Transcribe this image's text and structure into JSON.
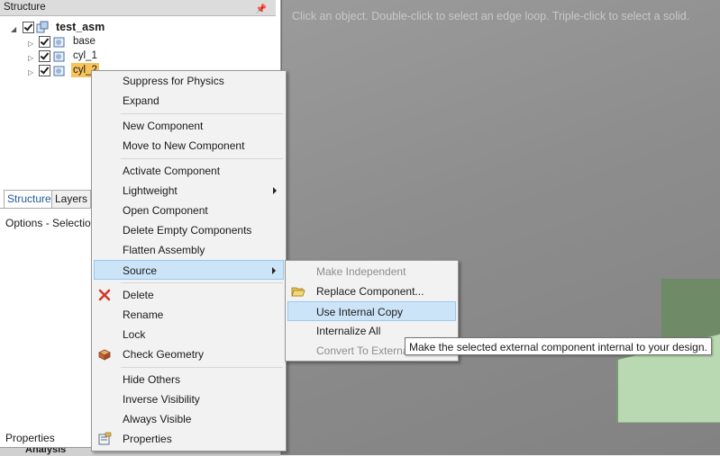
{
  "structure_panel": {
    "title": "Structure",
    "tree": [
      {
        "label": "test_asm"
      },
      {
        "label": "base"
      },
      {
        "label": "cyl_1"
      },
      {
        "label": "cyl_2"
      }
    ],
    "tabs": [
      "Structure",
      "Layers"
    ],
    "options_label": "Options - Selection",
    "properties_label": "Properties",
    "analysis_label": "Analysis"
  },
  "viewport": {
    "hint": "Click an object. Double-click to select an edge loop. Triple-click to select a solid."
  },
  "context_menu": {
    "items": [
      "Suppress for Physics",
      "Expand",
      "New Component",
      "Move to New Component",
      "Activate Component",
      "Lightweight",
      "Open Component",
      "Delete Empty Components",
      "Flatten Assembly",
      "Source",
      "Delete",
      "Rename",
      "Lock",
      "Check Geometry",
      "Hide Others",
      "Inverse Visibility",
      "Always Visible",
      "Properties"
    ]
  },
  "source_submenu": {
    "items": [
      "Make Independent",
      "Replace Component...",
      "Use Internal Copy",
      "Internalize All",
      "Convert To External"
    ]
  },
  "tooltip": "Make the selected external component internal to your design."
}
